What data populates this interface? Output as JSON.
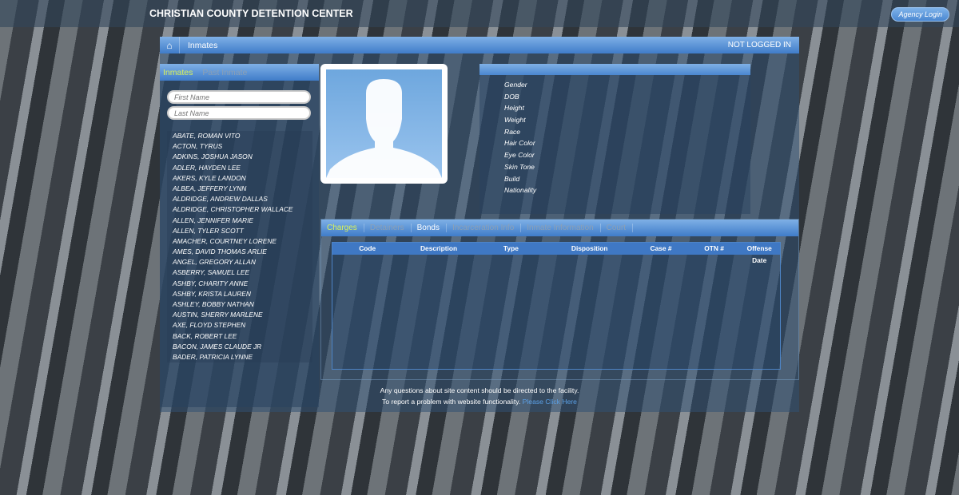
{
  "header": {
    "title": "CHRISTIAN COUNTY DETENTION CENTER",
    "agency_login": "Agency Login"
  },
  "breadcrumb": {
    "home_icon": "home-icon",
    "current": "Inmates",
    "status": "NOT LOGGED IN"
  },
  "left_tabs": {
    "active": "Inmates",
    "other": "Past Inmate"
  },
  "search": {
    "first_placeholder": "First Name",
    "last_placeholder": "Last Name"
  },
  "inmates": [
    "ABATE, ROMAN VITO",
    "ACTON, TYRUS",
    "ADKINS, JOSHUA JASON",
    "ADLER, HAYDEN LEE",
    "AKERS, KYLE LANDON",
    "ALBEA, JEFFERY LYNN",
    "ALDRIDGE, ANDREW DALLAS",
    "ALDRIDGE, CHRISTOPHER WALLACE",
    "ALLEN, JENNIFER MARIE",
    "ALLEN, TYLER SCOTT",
    "AMACHER, COURTNEY LORENE",
    "AMES, DAVID THOMAS ARLIE",
    "ANGEL, GREGORY ALLAN",
    "ASBERRY, SAMUEL LEE",
    "ASHBY, CHARITY ANNE",
    "ASHBY, KRISTA LAUREN",
    "ASHLEY, BOBBY NATHAN",
    "AUSTIN, SHERRY MARLENE",
    "AXE, FLOYD STEPHEN",
    "BACK, ROBERT LEE",
    "BACON, JAMES CLAUDE JR",
    "BADER, PATRICIA LYNNE"
  ],
  "details": {
    "fields": [
      "Gender",
      "DOB",
      "Height",
      "Weight",
      "Race",
      "Hair Color",
      "Eye Color",
      "Skin Tone",
      "Build",
      "Nationality"
    ]
  },
  "charge_tabs": [
    "Charges",
    "Detainers",
    "Bonds",
    "Incarceration Info",
    "Inmate Information",
    "Court"
  ],
  "charges_table": {
    "columns": [
      "Code",
      "Description",
      "Type",
      "Disposition",
      "Case #",
      "OTN #",
      "Offense Date"
    ],
    "rows": []
  },
  "footer": {
    "line1": "Any questions about site content should be directed to the facility.",
    "line2": "To report a problem with website functionality.",
    "link": "Please Click Here"
  },
  "colors": {
    "accent": "#4a86d0",
    "active_tab": "#d9f25a",
    "link": "#5aa0e6"
  }
}
